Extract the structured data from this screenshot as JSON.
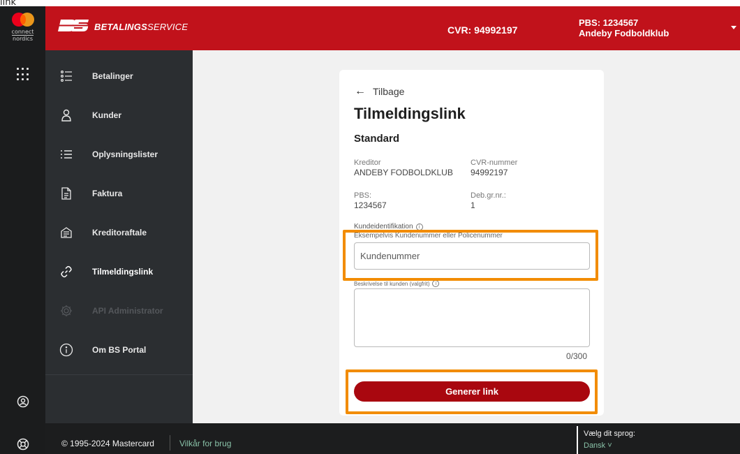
{
  "caption": "link",
  "brand": {
    "rail_logo_line1": "connect",
    "rail_logo_line2": "nordics",
    "product_bold": "BETALINGS",
    "product_rest": "SERVICE"
  },
  "header": {
    "cvr": "CVR: 94992197",
    "pbs": "PBS: 1234567",
    "org": "Andeby Fodboldklub"
  },
  "sidebar": {
    "items": [
      {
        "label": "Betalinger",
        "icon": "list-bullets-icon"
      },
      {
        "label": "Kunder",
        "icon": "person-icon"
      },
      {
        "label": "Oplysningslister",
        "icon": "list-icon"
      },
      {
        "label": "Faktura",
        "icon": "document-icon"
      },
      {
        "label": "Kreditoraftale",
        "icon": "agreement-icon"
      },
      {
        "label": "Tilmeldingslink",
        "icon": "link-icon"
      },
      {
        "label": "API Administrator",
        "icon": "gear-icon"
      },
      {
        "label": "Om BS Portal",
        "icon": "info-icon"
      }
    ]
  },
  "card": {
    "back_label": "Tilbage",
    "title": "Tilmeldingslink",
    "subtitle": "Standard",
    "kreditor_label": "Kreditor",
    "kreditor_value": "ANDEBY FODBOLDKLUB",
    "cvr_label": "CVR-nummer",
    "cvr_value": "94992197",
    "pbs_label": "PBS:",
    "pbs_value": "1234567",
    "debgr_label": "Deb.gr.nr.:",
    "debgr_value": "1",
    "kundeid_label": "Kundeidentifikation",
    "kundeid_hint": "Eksempelvis Kundenummer eller Policenummer",
    "kundeid_placeholder": "Kundenummer",
    "desc_label": "Beskrivelse til kunden (valgfrit)",
    "counter": "0/300",
    "generate_button": "Generer link"
  },
  "footer": {
    "copyright": "© 1995-2024 Mastercard",
    "terms": "Vilkår for brug",
    "language_prompt": "Vælg dit sprog:",
    "language_value": "Dansk ˅"
  },
  "colors": {
    "brand_red": "#c1121b",
    "button_red": "#a9070f",
    "highlight": "#f28c00",
    "sidebar": "#2b2e31"
  }
}
